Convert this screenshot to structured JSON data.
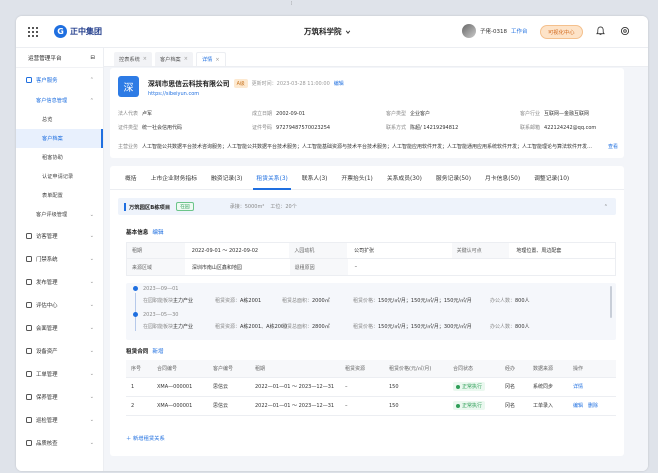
{
  "header": {
    "brand": "正中集团",
    "workspace": "万筑科学院",
    "user_name": "子佬-0318",
    "user_link": "工作台",
    "switch_label": "可视化中心"
  },
  "sidebar": {
    "title": "运营管理平台",
    "collapse": "⊟",
    "items": [
      {
        "label": "客户服务",
        "expanded": true
      },
      {
        "label": "访客管理"
      },
      {
        "label": "门禁系统"
      },
      {
        "label": "发布管理"
      },
      {
        "label": "评估中心"
      },
      {
        "label": "会面管理"
      },
      {
        "label": "设备资产"
      },
      {
        "label": "工单管理"
      },
      {
        "label": "保养管理"
      },
      {
        "label": "巡检管理"
      },
      {
        "label": "品质核查"
      }
    ],
    "sub_group": "客户信息管理",
    "leaves": [
      "总览",
      "客户档案",
      "租客协助",
      "认证申请记录",
      "表单配置"
    ],
    "sub_group2": "客户评级管理",
    "active_leaf": "客户档案"
  },
  "page_tabs": [
    {
      "label": "控表系统",
      "close": "×"
    },
    {
      "label": "客户档案",
      "close": "×"
    },
    {
      "label": "详情",
      "close": "×",
      "active": true
    }
  ],
  "company": {
    "logo_char": "深",
    "name": "深圳市思信云科技有限公司",
    "grade": "A级",
    "updated": "更新时间：2023-03-28 11:00:00",
    "edit": "编辑",
    "url": "https://sibeiyun.com",
    "fields": {
      "legal_k": "法人代表",
      "legal_v": "卢军",
      "found_k": "成立日期",
      "found_v": "2002-09-01",
      "type_k": "客户类型",
      "type_v": "企业客户",
      "industry_k": "客户行业",
      "industry_v": "互联网—金融互联网",
      "cert_k": "证件类型",
      "cert_v": "统一社会信用代码",
      "cert_no_k": "证件号码",
      "cert_no_v": "97279487570023254",
      "phone_k": "联系方式",
      "phone_v": "陈超/ 14219294812",
      "email_k": "联系邮箱",
      "email_v": "422124242@qq.com"
    },
    "scope_k": "主营业务",
    "scope_v": "人工智能公共数据平台技术咨询服务；人工智能公共数据平台技术服务；人工智能基础资源与技术平台技术服务；人工智能应用软件开发；人工智能通用应用系统软件开发；人工智能理论与算法软件开发…",
    "more": "查看"
  },
  "content_tabs": [
    "概括",
    "上市企业财务指标",
    "融资记录(3)",
    "租赁关系(3)",
    "联系人(3)",
    "开票抬头(1)",
    "关系成员(30)",
    "服务记录(50)",
    "月卡信息(50)",
    "调整记录(10)"
  ],
  "active_tab": "租赁关系(3)",
  "project": {
    "name": "万筑园区B栋项目",
    "status": "在园",
    "area": "承接：5000m²",
    "staff": "工位：20个",
    "collapse": "⌃"
  },
  "basic": {
    "title": "基本信息",
    "edit": "编辑",
    "rows": [
      [
        "租期",
        "2022-09-01 ～ 2022-09-02",
        "入园动机",
        "公司扩张",
        "关键认可点",
        "地理位置、周边配套"
      ],
      [
        "来源区域",
        "深圳市南山区鑫和地园",
        "退租原因",
        "–",
        "",
        ""
      ]
    ]
  },
  "timeline": [
    {
      "date": "2023—09—01",
      "cells": [
        "在园职能板块：",
        "主力产业",
        "租赁资源：",
        "A栋2001",
        "租赁总面积：",
        "2000㎡",
        "租赁价格：",
        "150元/㎡/月；150元/㎡/月；150元/㎡/月",
        "办公人数：",
        "800人"
      ]
    },
    {
      "date": "2023—05—30",
      "cells": [
        "在园职能板块：",
        "主力产业",
        "租赁资源：",
        "A栋2001、A栋2000",
        "租赁总面积：",
        "2800㎡",
        "租赁价格：",
        "150元/㎡/月；150元/㎡/月；300元/㎡/月",
        "办公人数：",
        "800人"
      ]
    }
  ],
  "contracts": {
    "title": "租赁合同",
    "add": "新增",
    "headers": [
      "序号",
      "合同编号",
      "客户编号",
      "租期",
      "租赁资源",
      "租赁价格(元/㎡/月)",
      "合同状态",
      "经办",
      "数据来源",
      "操作"
    ],
    "rows": [
      {
        "no": "1",
        "contract": "XMA—000001",
        "customer": "思信云",
        "term": "2022—01—01 ～ 2023—12—31",
        "resource": "–",
        "price": "150",
        "status": "正常执行",
        "agent": "冈名",
        "source": "系统同步",
        "ops": [
          "详情"
        ]
      },
      {
        "no": "2",
        "contract": "XMA—000001",
        "customer": "思信云",
        "term": "2022—01—01 ～ 2023—12—31",
        "resource": "–",
        "price": "150",
        "status": "正常执行",
        "agent": "冈名",
        "source": "工单录入",
        "ops": [
          "编辑",
          "删除"
        ]
      }
    ]
  },
  "add_relation": "＋ 新增租赁关系",
  "colors": {
    "primary": "#1f6fe0",
    "success": "#2f9e58",
    "grade_bg": "#fde9d0"
  }
}
